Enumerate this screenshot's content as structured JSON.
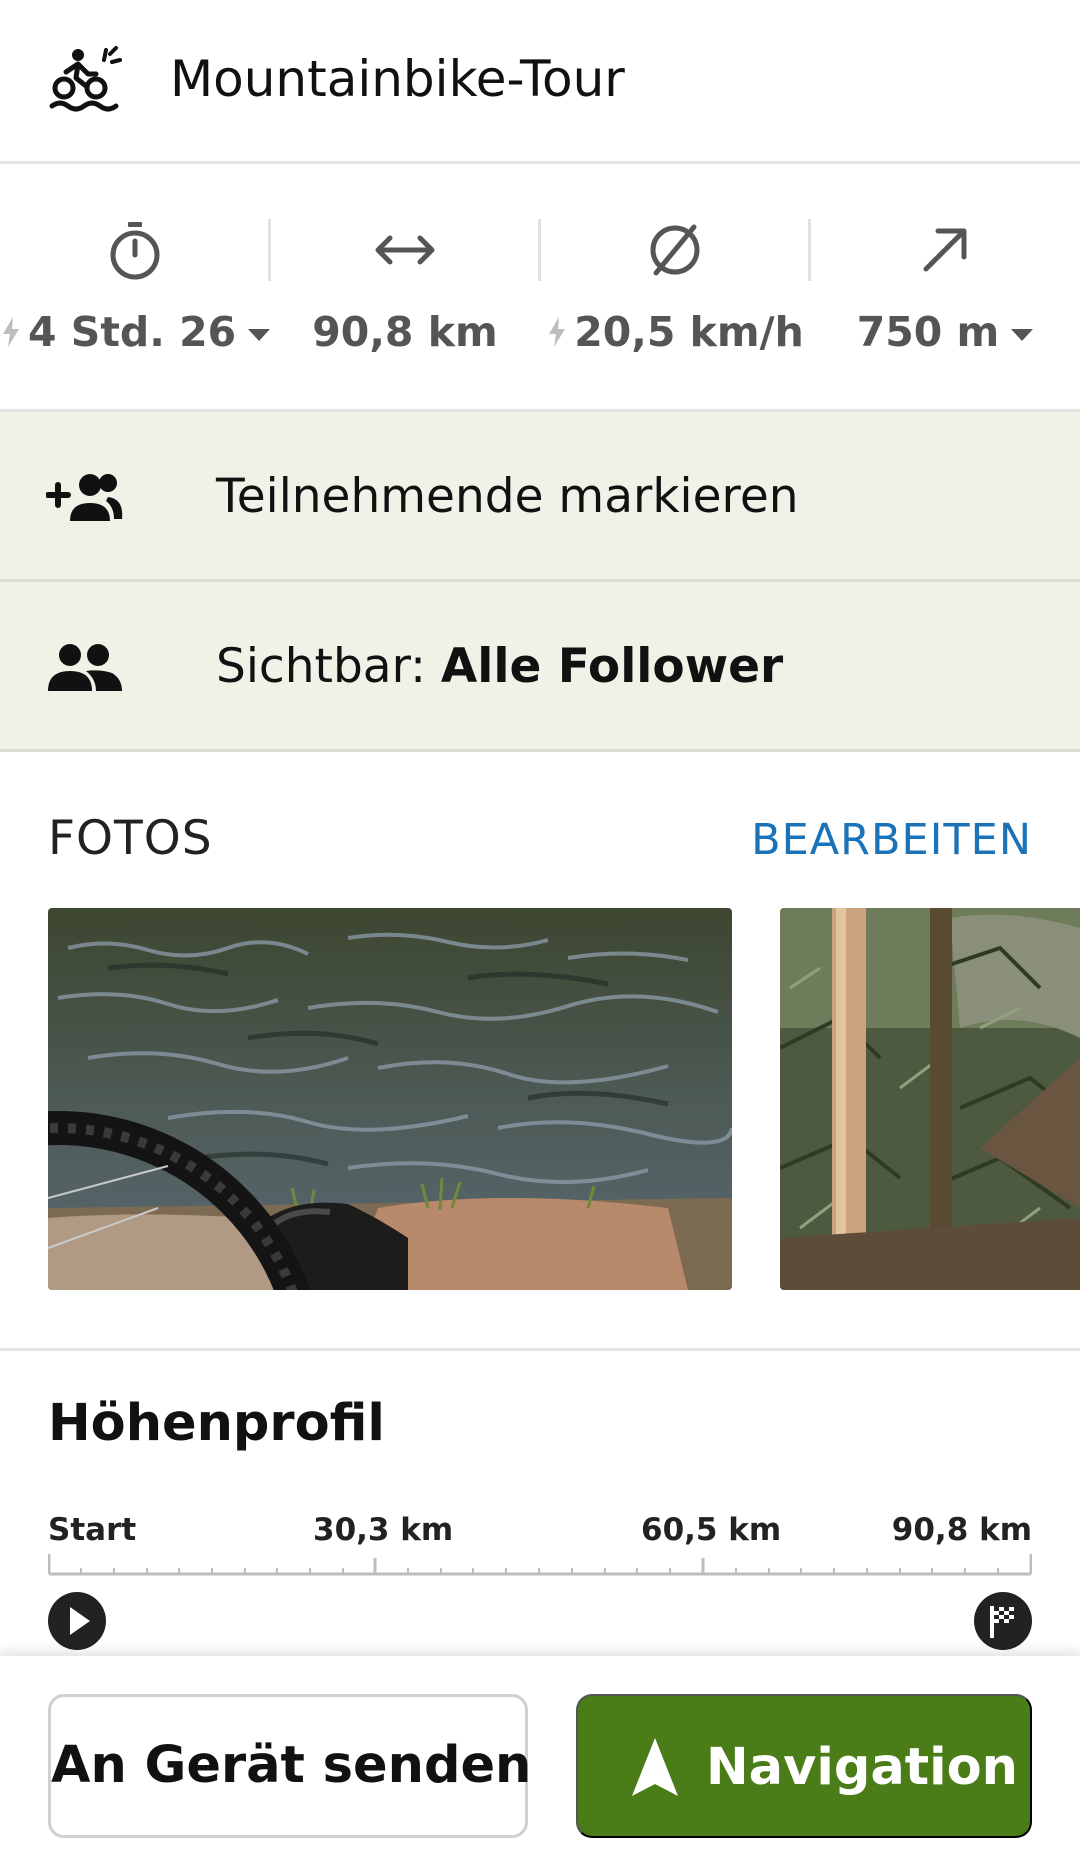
{
  "activity": {
    "sport_label": "Mountainbike-Tour",
    "sport_icon": "mountainbike-icon"
  },
  "stats": {
    "duration": "4 Std. 26",
    "distance": "90,8 km",
    "avg_speed": "20,5 km/h",
    "elevation_up": "750 m",
    "icons": [
      "stopwatch-icon",
      "distance-arrows-icon",
      "average-icon",
      "uphill-arrow-icon"
    ]
  },
  "participants": {
    "label": "Teilnehmende markieren",
    "icon": "add-person-icon"
  },
  "visibility": {
    "prefix": "Sichtbar:",
    "value": "Alle Follower",
    "icon": "people-icon"
  },
  "photos": {
    "title": "FOTOS",
    "edit_label": "BEARBEITEN"
  },
  "elevation_profile": {
    "title": "Höhenprofil",
    "axis_labels": [
      "Start",
      "30,3 km",
      "60,5 km",
      "90,8 km"
    ]
  },
  "actions": {
    "send_to_device": "An Gerät senden",
    "navigation": "Navigation"
  },
  "colors": {
    "accent_green": "#4a7d18",
    "link_blue": "#1a73b8",
    "row_background": "#f2f1e7"
  }
}
